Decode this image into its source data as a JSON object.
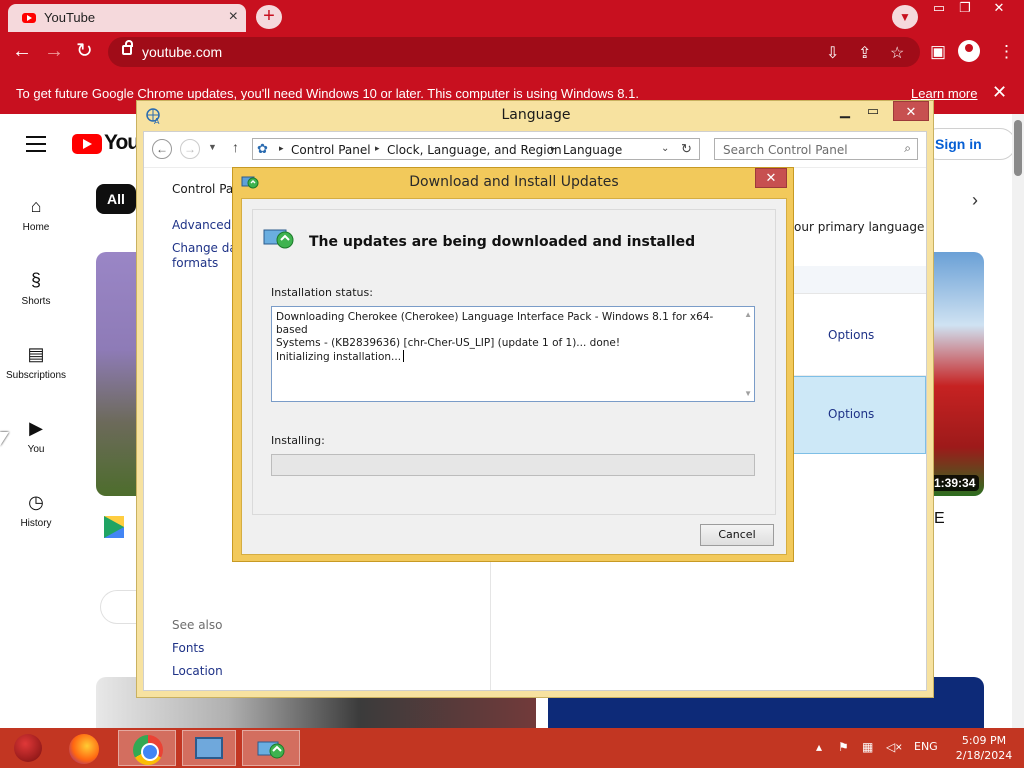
{
  "browser": {
    "tab_title": "YouTube",
    "url": "youtube.com",
    "infobar_text": "To get future Google Chrome updates, you'll need Windows 10 or later. This computer is using Windows 8.1.",
    "infobar_link": "Learn more"
  },
  "youtube": {
    "logo_text": "YouT",
    "chip_all": "All",
    "sign_in": "Sign in",
    "sidebar": [
      {
        "label": "Home",
        "icon": "home-icon"
      },
      {
        "label": "Shorts",
        "icon": "shorts-icon"
      },
      {
        "label": "Subscriptions",
        "icon": "subscriptions-icon"
      },
      {
        "label": "You",
        "icon": "you-icon"
      },
      {
        "label": "History",
        "icon": "history-icon"
      }
    ],
    "video_duration": "1:39:34",
    "right_partial_text": "E"
  },
  "control_panel": {
    "title": "Language",
    "breadcrumbs": [
      "Control Panel",
      "Clock, Language, and Region",
      "Language"
    ],
    "search_placeholder": "Search Control Panel",
    "left_links": [
      "Control Pan",
      "Advanced s",
      "Change dat",
      "formats"
    ],
    "see_also": "See also",
    "see_also_links": [
      "Fonts",
      "Location"
    ],
    "primary_language_text": "our primary language",
    "options_label": "Options"
  },
  "dialog": {
    "title": "Download and Install Updates",
    "heading": "The updates are being downloaded and installed",
    "installation_status_label": "Installation status:",
    "status_lines": [
      "Downloading Cherokee (Cherokee) Language Interface Pack - Windows 8.1 for x64-based",
      "Systems - (KB2839636) [chr-Cher-US_LIP] (update 1 of 1)... done!",
      "Initializing installation..."
    ],
    "installing_label": "Installing:",
    "progress_percent": 0,
    "cancel_label": "Cancel"
  },
  "taskbar": {
    "language": "ENG",
    "time": "5:09 PM",
    "date": "2/18/2024"
  }
}
